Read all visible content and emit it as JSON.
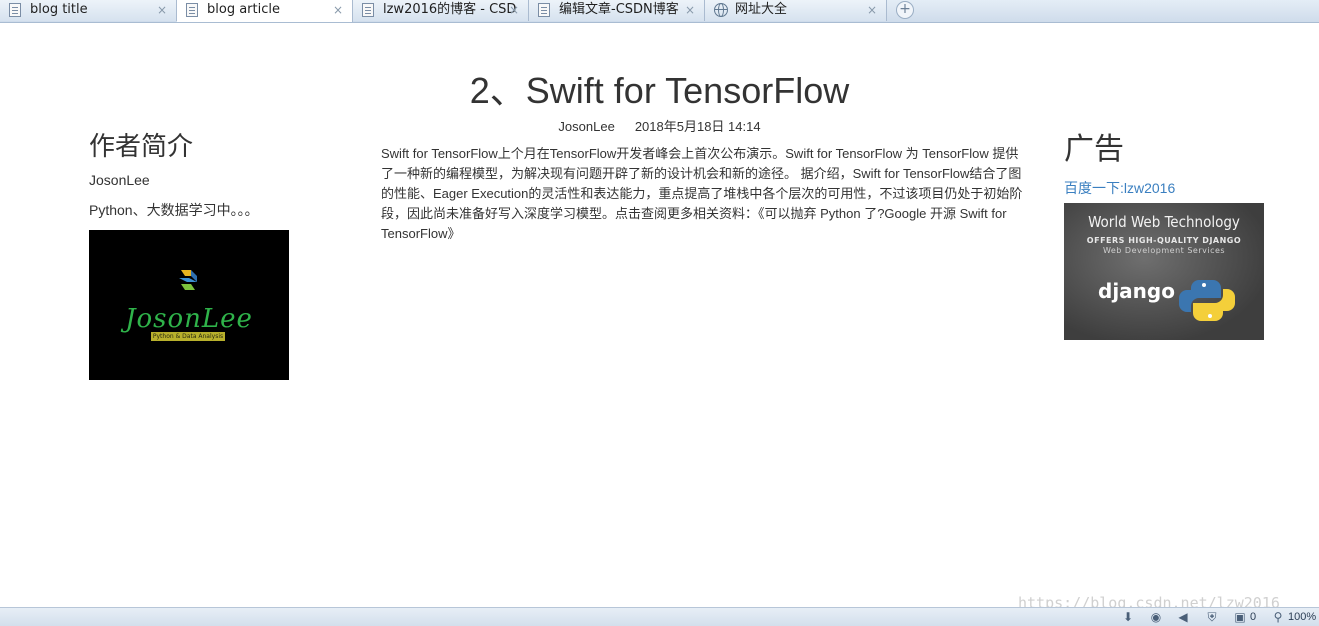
{
  "browser": {
    "tabs": [
      {
        "label": "blog title",
        "icon": "page-icon",
        "active": false
      },
      {
        "label": "blog article",
        "icon": "page-icon",
        "active": true
      },
      {
        "label": "lzw2016的博客 - CSD",
        "icon": "page-icon",
        "active": false
      },
      {
        "label": "编辑文章-CSDN博客",
        "icon": "page-icon",
        "active": false
      },
      {
        "label": "网址大全",
        "icon": "globe-icon",
        "active": false
      }
    ],
    "close_glyph": "×",
    "new_tab_glyph": "+"
  },
  "article": {
    "title": "2、Swift for TensorFlow",
    "author": "JosonLee",
    "date": "2018年5月18日 14:14",
    "body": "Swift for TensorFlow上个月在TensorFlow开发者峰会上首次公布演示。Swift for TensorFlow 为 TensorFlow 提供了一种新的编程模型，为解决现有问题开辟了新的设计机会和新的途径。 据介绍，Swift for TensorFlow结合了图的性能、Eager Execution的灵活性和表达能力，重点提高了堆栈中各个层次的可用性，不过该项目仍处于初始阶段，因此尚未准备好写入深度学习模型。点击查阅更多相关资料：《可以抛弃 Python 了?Google 开源 Swift for TensorFlow》"
  },
  "sidebar_left": {
    "heading": "作者简介",
    "name": "JosonLee",
    "bio": "Python、大数据学习中。。。",
    "image": {
      "logo_text": "JosonLee",
      "logo_sub": "Python & Data Analysis"
    }
  },
  "sidebar_right": {
    "heading": "广告",
    "link": "百度一下:lzw2016",
    "ad": {
      "headline": "World Web Technology",
      "sub1": "OFFERS HIGH-QUALITY DJANGO",
      "sub2": "Web Development Services",
      "brand": "django"
    }
  },
  "watermark": "https://blog.csdn.net/lzw2016",
  "statusbar": {
    "count": "0",
    "zoom": "100%"
  },
  "colors": {
    "link": "#3a7fc0",
    "text": "#333333",
    "tab_bar": "#cfdceb"
  }
}
